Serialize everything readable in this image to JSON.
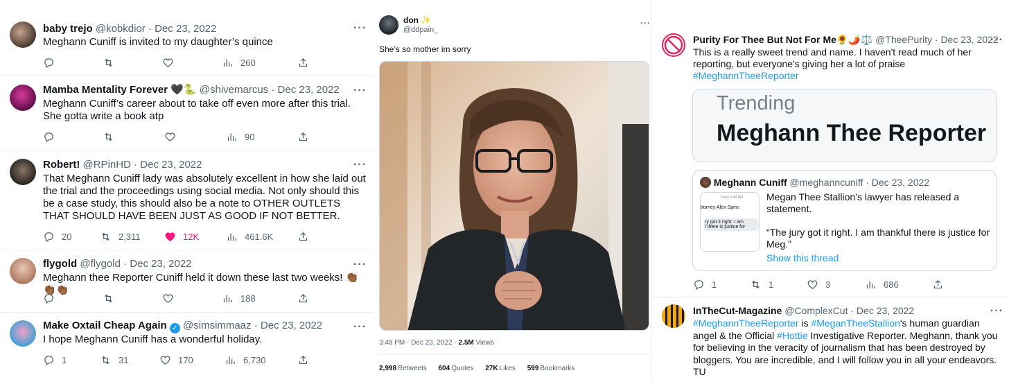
{
  "left_tweets": [
    {
      "name": "baby trejo",
      "handle": "@kobkdior",
      "date": "· Dec 23, 2022",
      "text": "Meghann Cuniff is invited to my daughter’s quince",
      "replies": "",
      "retweets": "",
      "likes": "",
      "views": "260"
    },
    {
      "name": "Mamba Mentality Forever",
      "name_emoji": "🖤🐍",
      "handle": "@shivemarcus",
      "date": "· Dec 23, 2022",
      "text": "Meghann Cuniff’s career about to take off even more after this trial. She gotta write a book atp",
      "replies": "",
      "retweets": "",
      "likes": "",
      "views": "90"
    },
    {
      "name": "Robert!",
      "handle": "@RPinHD",
      "date": "· Dec 23, 2022",
      "text": "That Meghann Cuniff lady was absolutely excellent in how she laid out the trial and the proceedings using social media. Not only should this be a case study, this should also be a note to OTHER OUTLETS THAT SHOULD HAVE BEEN JUST AS GOOD IF NOT BETTER.",
      "replies": "20",
      "retweets": "2,311",
      "likes": "12K",
      "views": "461.6K"
    },
    {
      "name": "flygold",
      "handle": "@flygold",
      "date": "· Dec 23, 2022",
      "text": "Meghann thee Reporter Cuniff held it down these last two weeks! 👏🏾👏🏾👏🏾",
      "replies": "",
      "retweets": "",
      "likes": "",
      "views": "188"
    },
    {
      "name": "Make Oxtail Cheap Again",
      "handle": "@simsimmaaz",
      "date": "· Dec 23, 2022",
      "text": "I hope Meghann Cuniff has a wonderful holiday.",
      "replies": "1",
      "retweets": "31",
      "likes": "170",
      "views": "6,730"
    }
  ],
  "mid_tweet": {
    "name": "don ✨",
    "handle": "@ddpain_",
    "text": "She’s so mother im sorry",
    "time": "3:48 PM · Dec 23, 2022 · ",
    "views_count": "2.5M",
    "views_label": "Views",
    "retweets_count": "2,998",
    "retweets_label": "Retweets",
    "quotes_count": "604",
    "quotes_label": "Quotes",
    "likes_count": "27K",
    "likes_label": "Likes",
    "bookmarks_count": "599",
    "bookmarks_label": "Bookmarks"
  },
  "right_tweet_1": {
    "name": "Purity For Thee But Not For Me",
    "name_emoji": "🌻🌶️⚖️",
    "handle": "@TheePurity",
    "date": "· Dec 23, 2022",
    "text": "This is a really sweet trend and name. I haven't read much of her reporting, but everyone's giving her a lot of praise",
    "hashtag": "#MeghannTheeReporter",
    "card_small": "Trending",
    "card_big": "Meghann Thee Reporter",
    "quote_name": "Meghann Cuniff",
    "quote_handle": "@meghanncuniff · Dec 23, 2022",
    "quote_thumb_time": "Today 3:44 PM",
    "quote_thumb_l1": "ttorney Alex Spiro:",
    "quote_thumb_l2": "ry got it right. I am",
    "quote_thumb_l3": "l there is justice for",
    "quote_text": "Megan Thee Stallion’s lawyer has released a statement.",
    "quote_text2": "“The jury got it right. I am thankful there is justice for Meg.”",
    "quote_link": "Show this thread",
    "replies": "1",
    "retweets": "1",
    "likes": "3",
    "views": "686"
  },
  "right_tweet_2": {
    "name": "InTheCut-Magazine",
    "handle": "@ComplexCut",
    "date": "· Dec 23, 2022",
    "tag1": "#MeghannTheeReporter",
    "w1": " is ",
    "tag2": "#MeganTheeStallion",
    "w2": "'s human guardian angel & the Official ",
    "tag3": "#Hottie",
    "w3": " Investigative Reporter. Meghann, thank you for believing in the veracity of journalism that has been destroyed by bloggers. You are incredible, and I will follow you in all your endeavors. TU"
  },
  "more_label": "···"
}
